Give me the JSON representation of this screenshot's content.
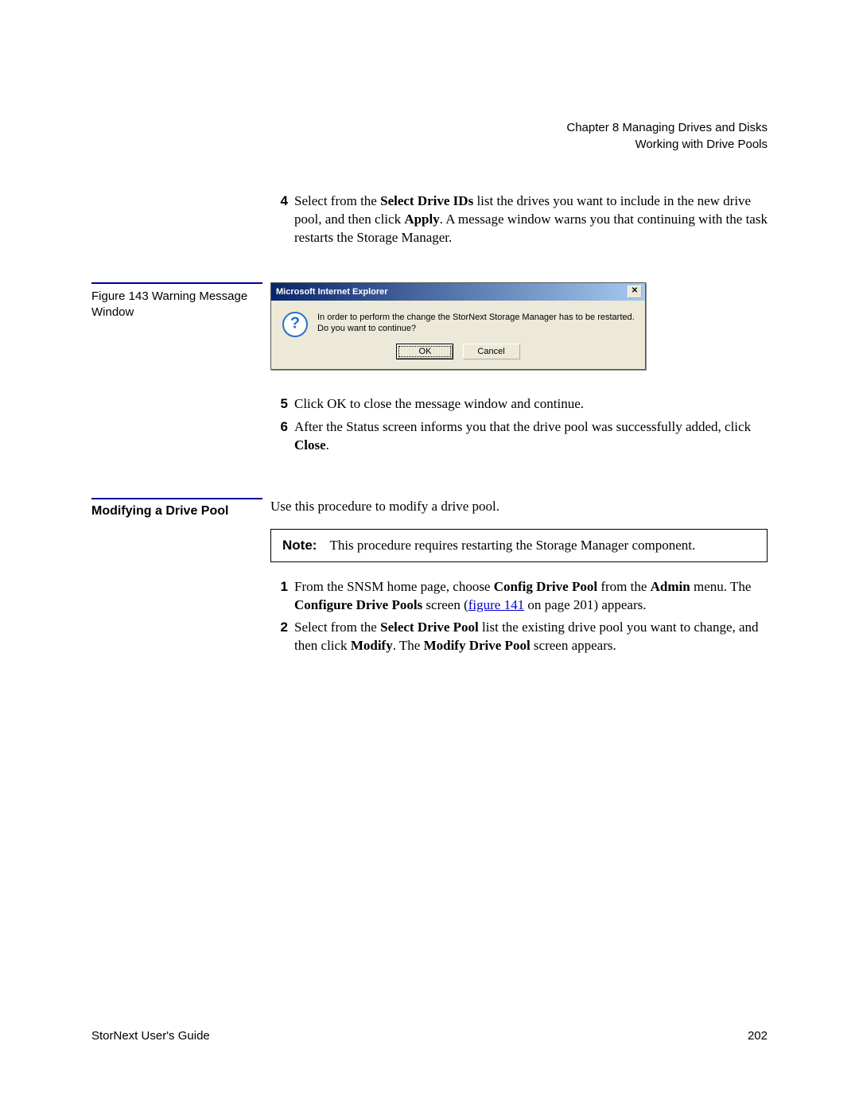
{
  "header": {
    "chapter": "Chapter 8  Managing Drives and Disks",
    "section": "Working with Drive Pools"
  },
  "steps_a": {
    "s4": {
      "num": "4",
      "t1": "Select from the ",
      "b1": "Select Drive IDs",
      "t2": " list the drives you want to include in the new drive pool, and then click ",
      "b2": "Apply",
      "t3": ". A message window warns you that continuing with the task restarts the Storage Manager."
    }
  },
  "figure": {
    "caption": "Figure 143  Warning Message Window"
  },
  "dialog": {
    "title": "Microsoft Internet Explorer",
    "close": "✕",
    "line1": "In order to perform the change the StorNext Storage Manager has to be restarted.",
    "line2": "Do you want to continue?",
    "ok": "OK",
    "cancel": "Cancel"
  },
  "steps_b": {
    "s5": {
      "num": "5",
      "t1": "Click OK to close the message window and continue."
    },
    "s6": {
      "num": "6",
      "t1": "After the Status screen informs you that the drive pool was successfully added, click ",
      "b1": "Close",
      "t2": "."
    }
  },
  "section2": {
    "heading": "Modifying a Drive Pool",
    "intro": "Use this procedure to modify a drive pool."
  },
  "note": {
    "label": "Note:",
    "text": "This procedure requires restarting the Storage Manager component."
  },
  "steps_c": {
    "s1": {
      "num": "1",
      "t1": "From the SNSM home page, choose ",
      "b1": "Config Drive Pool",
      "t2": " from the ",
      "b2": "Admin",
      "t3": " menu. The ",
      "b3": "Configure Drive Pools",
      "t4": " screen (",
      "link": "figure 141",
      "t5": " on page 201) appears."
    },
    "s2": {
      "num": "2",
      "t1": "Select from the ",
      "b1": "Select Drive Pool",
      "t2": " list the existing drive pool you want to change, and then click ",
      "b2": "Modify",
      "t3": ". The ",
      "b3": "Modify Drive Pool",
      "t4": " screen appears."
    }
  },
  "footer": {
    "guide": "StorNext User's Guide",
    "page": "202"
  }
}
